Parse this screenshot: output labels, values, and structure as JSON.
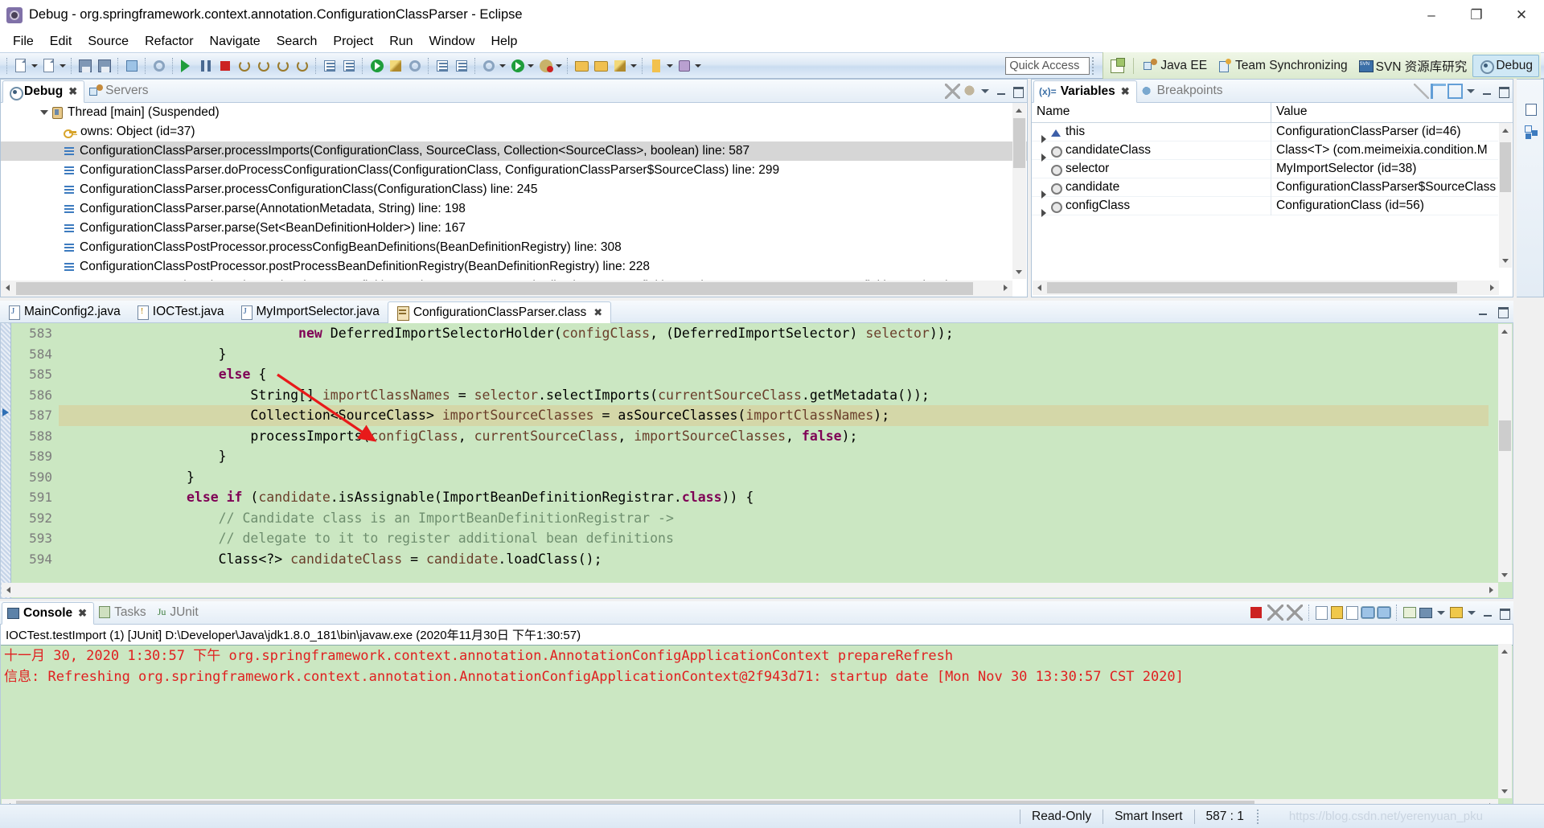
{
  "window": {
    "title": "Debug - org.springframework.context.annotation.ConfigurationClassParser - Eclipse",
    "app_icon": "eclipse-icon",
    "minimize": "–",
    "maximize": "❐",
    "close": "✕"
  },
  "menu": [
    "File",
    "Edit",
    "Source",
    "Refactor",
    "Navigate",
    "Search",
    "Project",
    "Run",
    "Window",
    "Help"
  ],
  "toolbar": {
    "quick_access_placeholder": "Quick Access"
  },
  "perspectives": {
    "open_perspective_tooltip": "Open Perspective",
    "items": [
      {
        "label": "Java EE",
        "icon": "java-ee-icon",
        "active": false
      },
      {
        "label": "Team Synchronizing",
        "icon": "team-sync-icon",
        "active": false
      },
      {
        "label": "SVN 资源库研究",
        "icon": "svn-icon",
        "active": false
      },
      {
        "label": "Debug",
        "icon": "debug-icon",
        "active": true
      }
    ]
  },
  "debug_view": {
    "tabs": [
      {
        "label": "Debug",
        "icon": "debug-icon",
        "active": true,
        "closeable": true
      },
      {
        "label": "Servers",
        "icon": "servers-icon",
        "active": false,
        "closeable": false
      }
    ],
    "rows": [
      {
        "indent": 1,
        "icon": "thread-icon",
        "twisty": true,
        "label": "Thread [main] (Suspended)",
        "selected": false
      },
      {
        "indent": 2,
        "icon": "monitor-key-icon",
        "twisty": false,
        "label": "owns: Object  (id=37)",
        "selected": false
      },
      {
        "indent": 2,
        "icon": "stack-frame-icon",
        "twisty": false,
        "label": "ConfigurationClassParser.processImports(ConfigurationClass, SourceClass, Collection<SourceClass>, boolean) line: 587",
        "selected": true
      },
      {
        "indent": 2,
        "icon": "stack-frame-icon",
        "twisty": false,
        "label": "ConfigurationClassParser.doProcessConfigurationClass(ConfigurationClass, ConfigurationClassParser$SourceClass) line: 299",
        "selected": false
      },
      {
        "indent": 2,
        "icon": "stack-frame-icon",
        "twisty": false,
        "label": "ConfigurationClassParser.processConfigurationClass(ConfigurationClass) line: 245",
        "selected": false
      },
      {
        "indent": 2,
        "icon": "stack-frame-icon",
        "twisty": false,
        "label": "ConfigurationClassParser.parse(AnnotationMetadata, String) line: 198",
        "selected": false
      },
      {
        "indent": 2,
        "icon": "stack-frame-icon",
        "twisty": false,
        "label": "ConfigurationClassParser.parse(Set<BeanDefinitionHolder>) line: 167",
        "selected": false
      },
      {
        "indent": 2,
        "icon": "stack-frame-icon",
        "twisty": false,
        "label": "ConfigurationClassPostProcessor.processConfigBeanDefinitions(BeanDefinitionRegistry) line: 308",
        "selected": false
      },
      {
        "indent": 2,
        "icon": "stack-frame-icon",
        "twisty": false,
        "label": "ConfigurationClassPostProcessor.postProcessBeanDefinitionRegistry(BeanDefinitionRegistry) line: 228",
        "selected": false
      },
      {
        "indent": 2,
        "icon": "stack-frame-icon",
        "twisty": false,
        "label": "PostProcessorRegistrationDelegate.invokeBeanDefinitionRegistryPostProcessors(Collection<BeanDefinitionRegistryPostProcessor>, BeanDefinitionRegistry)",
        "selected": false
      }
    ]
  },
  "variables_view": {
    "tabs": [
      {
        "label": "Variables",
        "icon": "variables-icon",
        "active": true,
        "closeable": true
      },
      {
        "label": "Breakpoints",
        "icon": "breakpoints-icon",
        "active": false,
        "closeable": false
      }
    ],
    "columns": [
      "Name",
      "Value"
    ],
    "rows": [
      {
        "expandable": true,
        "icon": "this-icon",
        "name": "this",
        "value": "ConfigurationClassParser  (id=46)"
      },
      {
        "expandable": true,
        "icon": "local-icon",
        "name": "candidateClass",
        "value": "Class<T> (com.meimeixia.condition.M"
      },
      {
        "expandable": false,
        "icon": "local-icon",
        "name": "selector",
        "value": "MyImportSelector  (id=38)"
      },
      {
        "expandable": true,
        "icon": "local-icon",
        "name": "candidate",
        "value": "ConfigurationClassParser$SourceClass"
      },
      {
        "expandable": true,
        "icon": "local-icon",
        "name": "configClass",
        "value": "ConfigurationClass  (id=56)"
      }
    ]
  },
  "editor": {
    "tabs": [
      {
        "label": "MainConfig2.java",
        "icon": "java-file-icon",
        "active": false,
        "closeable": false
      },
      {
        "label": "IOCTest.java",
        "icon": "java-file-warning-icon",
        "active": false,
        "closeable": false
      },
      {
        "label": "MyImportSelector.java",
        "icon": "java-file-icon",
        "active": false,
        "closeable": false
      },
      {
        "label": "ConfigurationClassParser.class",
        "icon": "class-file-icon",
        "active": true,
        "closeable": true
      }
    ],
    "current_line": 587,
    "lines": [
      {
        "n": 583,
        "segments": [
          {
            "t": "                              ",
            "c": ""
          },
          {
            "t": "new",
            "c": "kw"
          },
          {
            "t": " DeferredImportSelectorHolder(",
            "c": ""
          },
          {
            "t": "configClass",
            "c": "id"
          },
          {
            "t": ", (DeferredImportSelector) ",
            "c": ""
          },
          {
            "t": "selector",
            "c": "id"
          },
          {
            "t": "));",
            "c": ""
          }
        ]
      },
      {
        "n": 584,
        "segments": [
          {
            "t": "                    }",
            "c": ""
          }
        ]
      },
      {
        "n": 585,
        "segments": [
          {
            "t": "                    ",
            "c": ""
          },
          {
            "t": "else",
            "c": "kw"
          },
          {
            "t": " {",
            "c": ""
          }
        ]
      },
      {
        "n": 586,
        "segments": [
          {
            "t": "                        String[] ",
            "c": ""
          },
          {
            "t": "importClassNames",
            "c": "id"
          },
          {
            "t": " = ",
            "c": ""
          },
          {
            "t": "selector",
            "c": "id"
          },
          {
            "t": ".selectImports(",
            "c": ""
          },
          {
            "t": "currentSourceClass",
            "c": "id"
          },
          {
            "t": ".getMetadata());",
            "c": ""
          }
        ]
      },
      {
        "n": 587,
        "segments": [
          {
            "t": "                        Collection<SourceClass> ",
            "c": ""
          },
          {
            "t": "importSourceClasses",
            "c": "id"
          },
          {
            "t": " = asSourceClasses(",
            "c": ""
          },
          {
            "t": "importClassNames",
            "c": "id"
          },
          {
            "t": ");",
            "c": ""
          }
        ]
      },
      {
        "n": 588,
        "segments": [
          {
            "t": "                        processImports(",
            "c": ""
          },
          {
            "t": "configClass",
            "c": "id"
          },
          {
            "t": ", ",
            "c": ""
          },
          {
            "t": "currentSourceClass",
            "c": "id"
          },
          {
            "t": ", ",
            "c": ""
          },
          {
            "t": "importSourceClasses",
            "c": "id"
          },
          {
            "t": ", ",
            "c": ""
          },
          {
            "t": "false",
            "c": "kw"
          },
          {
            "t": ");",
            "c": ""
          }
        ]
      },
      {
        "n": 589,
        "segments": [
          {
            "t": "                    }",
            "c": ""
          }
        ]
      },
      {
        "n": 590,
        "segments": [
          {
            "t": "                }",
            "c": ""
          }
        ]
      },
      {
        "n": 591,
        "segments": [
          {
            "t": "                ",
            "c": ""
          },
          {
            "t": "else if",
            "c": "kw"
          },
          {
            "t": " (",
            "c": ""
          },
          {
            "t": "candidate",
            "c": "id"
          },
          {
            "t": ".isAssignable(ImportBeanDefinitionRegistrar.",
            "c": ""
          },
          {
            "t": "class",
            "c": "kw"
          },
          {
            "t": ")) {",
            "c": ""
          }
        ]
      },
      {
        "n": 592,
        "segments": [
          {
            "t": "                    // Candidate class is an ImportBeanDefinitionRegistrar ->",
            "c": "cm"
          }
        ]
      },
      {
        "n": 593,
        "segments": [
          {
            "t": "                    // delegate to it to register additional bean definitions",
            "c": "cm"
          }
        ]
      },
      {
        "n": 594,
        "segments": [
          {
            "t": "                    Class<?> ",
            "c": ""
          },
          {
            "t": "candidateClass",
            "c": "id"
          },
          {
            "t": " = ",
            "c": ""
          },
          {
            "t": "candidate",
            "c": "id"
          },
          {
            "t": ".loadClass();",
            "c": ""
          }
        ]
      }
    ]
  },
  "console_view": {
    "tabs": [
      {
        "label": "Console",
        "icon": "console-icon",
        "active": true,
        "closeable": true
      },
      {
        "label": "Tasks",
        "icon": "tasks-icon",
        "active": false,
        "closeable": false
      },
      {
        "label": "JUnit",
        "icon": "junit-icon",
        "active": false,
        "closeable": false
      }
    ],
    "launch_line": "IOCTest.testImport (1) [JUnit] D:\\Developer\\Java\\jdk1.8.0_181\\bin\\javaw.exe (2020年11月30日 下午1:30:57)",
    "output": [
      "十一月 30, 2020 1:30:57 下午 org.springframework.context.annotation.AnnotationConfigApplicationContext prepareRefresh",
      "信息: Refreshing org.springframework.context.annotation.AnnotationConfigApplicationContext@2f943d71: startup date [Mon Nov 30 13:30:57 CST 2020]"
    ]
  },
  "statusbar": {
    "read_only": "Read-Only",
    "insert_mode": "Smart Insert",
    "position": "587 : 1",
    "watermark": "https://blog.csdn.net/yerenyuan_pku"
  }
}
